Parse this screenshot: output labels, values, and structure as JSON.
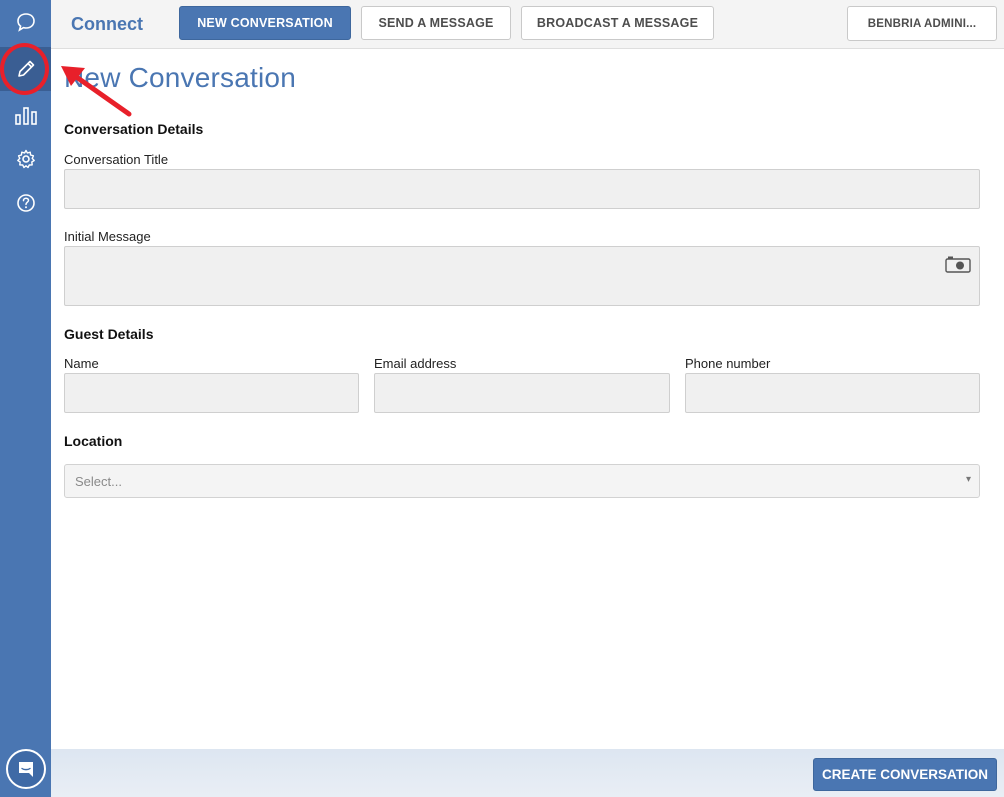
{
  "app": {
    "title": "Connect"
  },
  "sidebar": {
    "items": [
      {
        "icon": "chat-bubble-icon"
      },
      {
        "icon": "pencil-icon",
        "active": true
      },
      {
        "icon": "bar-chart-icon"
      },
      {
        "icon": "gear-icon"
      },
      {
        "icon": "help-icon"
      }
    ],
    "launcher_icon": "chat-launcher-icon"
  },
  "topbar": {
    "new_conversation": "NEW CONVERSATION",
    "send_message": "SEND A MESSAGE",
    "broadcast_message": "BROADCAST A MESSAGE",
    "user_menu": "BENBRIA ADMINI..."
  },
  "page": {
    "title": "New Conversation",
    "conversation_details": {
      "heading": "Conversation Details",
      "title_label": "Conversation Title",
      "title_value": "",
      "message_label": "Initial Message",
      "message_value": "",
      "camera_icon": "camera-icon"
    },
    "guest_details": {
      "heading": "Guest Details",
      "name_label": "Name",
      "name_value": "",
      "email_label": "Email address",
      "email_value": "",
      "phone_label": "Phone number",
      "phone_value": ""
    },
    "location": {
      "heading": "Location",
      "placeholder": "Select...",
      "caret": "▾"
    }
  },
  "footer": {
    "create_button": "CREATE CONVERSATION"
  },
  "colors": {
    "accent": "#4a76b2",
    "annotation": "#e8202a"
  }
}
